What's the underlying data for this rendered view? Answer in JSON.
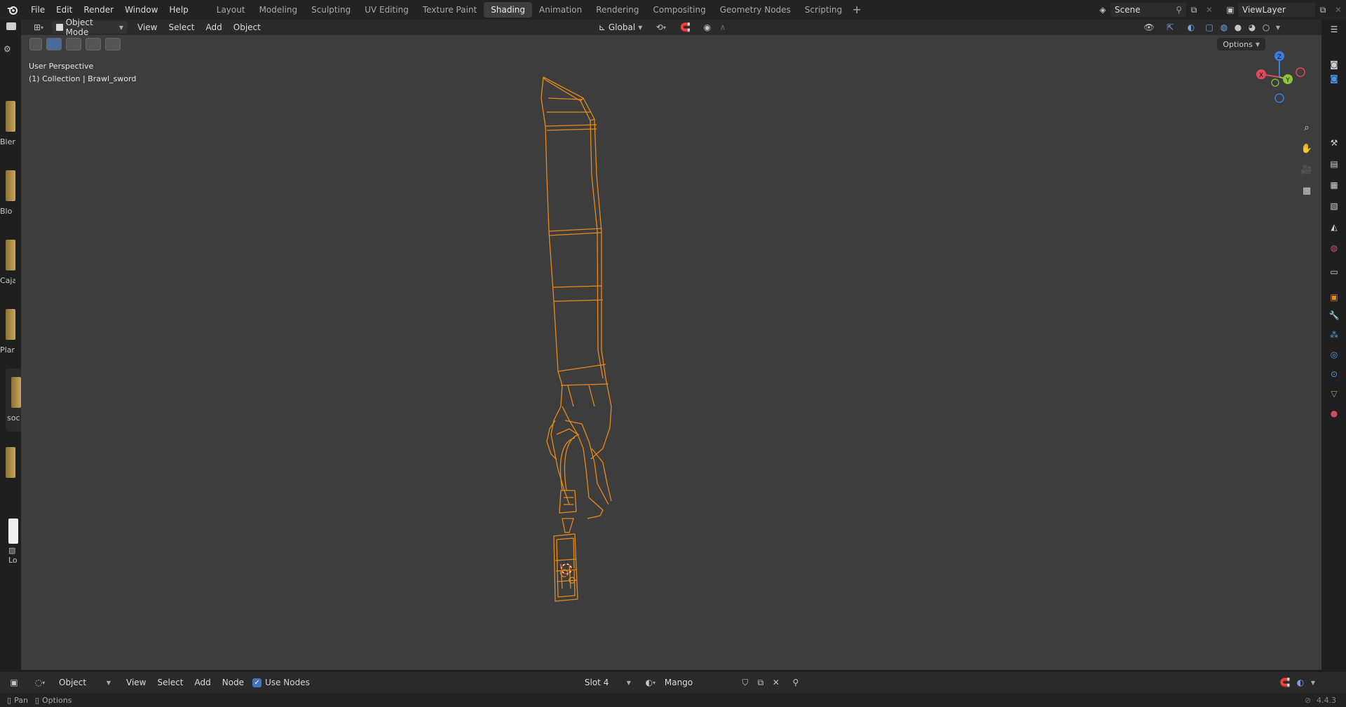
{
  "topbar": {
    "menus": [
      "File",
      "Edit",
      "Render",
      "Window",
      "Help"
    ],
    "workspaces": [
      "Layout",
      "Modeling",
      "Sculpting",
      "UV Editing",
      "Texture Paint",
      "Shading",
      "Animation",
      "Rendering",
      "Compositing",
      "Geometry Nodes",
      "Scripting"
    ],
    "active_workspace": "Shading",
    "scene_name": "Scene",
    "view_layer": "ViewLayer"
  },
  "viewport_header": {
    "mode": "Object Mode",
    "menus": [
      "View",
      "Select",
      "Add",
      "Object"
    ],
    "orientation": "Global",
    "options_label": "Options"
  },
  "viewport": {
    "perspective_label": "User Perspective",
    "collection_label": "(1) Collection | Brawl_sword",
    "wire_color": "#e88a1a",
    "background_color": "#3d3d3d",
    "gizmo": {
      "x": "X",
      "y": "Y",
      "z": "Z"
    }
  },
  "asset_strip": {
    "items": [
      "Blen",
      "Blo",
      "Caja",
      "Plar",
      "soc",
      "",
      "Lo"
    ]
  },
  "bottom_header": {
    "editor": "Object",
    "menus": [
      "View",
      "Select",
      "Add",
      "Node"
    ],
    "use_nodes_label": "Use Nodes",
    "slot": "Slot 4",
    "material": "Mango"
  },
  "statusbar": {
    "pan": "Pan",
    "options": "Options",
    "version": "4.4.3"
  }
}
